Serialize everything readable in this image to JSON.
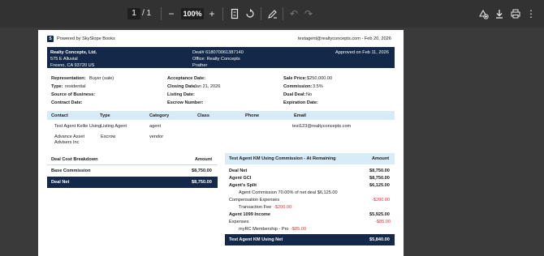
{
  "toolbar": {
    "page_current": "1",
    "page_total": "/ 1",
    "zoom": "100%"
  },
  "doc": {
    "powered_by": "Powered by SkySlope Books",
    "header_right": "testagent@realtyconcepts.com - Feb 20, 2026",
    "company": "Realty Concepts, Ltd.",
    "addr1": "575 E Alluvial",
    "addr2": "Fresno, CA 93720 US",
    "deal_no": "Deal# 618070061387140",
    "office": "Office: Realty Concepts",
    "office2": "Prather",
    "approved": "Approved on Feb 11, 2026",
    "fields": {
      "representation_label": "Representation:",
      "representation_value": "Buyer (sale)",
      "type_label": "Type:",
      "type_value": "residential",
      "source_label": "Source of Business:",
      "contract_label": "Contract Date:",
      "acceptance_label": "Acceptance Date:",
      "closing_label": "Closing Date:",
      "closing_value": "Jan 21, 2026",
      "listing_label": "Listing Date:",
      "escrow_label": "Escrow Number:",
      "sale_price_label": "Sale Price:",
      "sale_price_value": "$250,000.00",
      "commission_label": "Commission:",
      "commission_value": "3.5%",
      "dual_label": "Dual Deal:",
      "dual_value": "No",
      "expiration_label": "Expiration Date:"
    },
    "contacts": {
      "headers": [
        "Contact",
        "Type",
        "Category",
        "Class",
        "Phone",
        "Email"
      ],
      "rows": [
        {
          "contact": "Test Agent Kellie Using",
          "type": "Listing Agent",
          "category": "agent",
          "email": "test123@realtyconcepts.com"
        },
        {
          "contact": "Advance Asset",
          "contact2": "Advisers Inc",
          "type": "Escrow",
          "category": "vendor"
        }
      ]
    },
    "cost": {
      "title": "Deal Cost Breakdown",
      "amount_header": "Amount",
      "base_label": "Base Commission",
      "base_value": "$8,750.00",
      "net_label": "Deal Net",
      "net_value": "$8,750.00"
    },
    "agent": {
      "title": "Test Agent KM Using Commission - At Remaining",
      "amount_header": "Amount",
      "deal_net_label": "Deal Net",
      "deal_net_value": "$8,750.00",
      "gci_label": "Agent GCI",
      "gci_value": "$8,750.00",
      "split_label": "Agent's Split",
      "split_value": "$6,125.00",
      "split_detail": "Agent Commission 70.00% of net deal $6,125.00",
      "comp_label": "Compensation Expenses",
      "comp_value": "-$200.00",
      "txn_fee": "Transaction Fee",
      "txn_fee_value": "-$200.00",
      "income_label": "Agent 1099 Income",
      "income_value": "$5,925.00",
      "exp_label": "Expenses",
      "exp_value": "-$85.00",
      "membership": "myRC Membership - Pro",
      "membership_value": "-$85.00",
      "net_label": "Test Agent KM Using Net",
      "net_value": "$5,840.00"
    }
  }
}
